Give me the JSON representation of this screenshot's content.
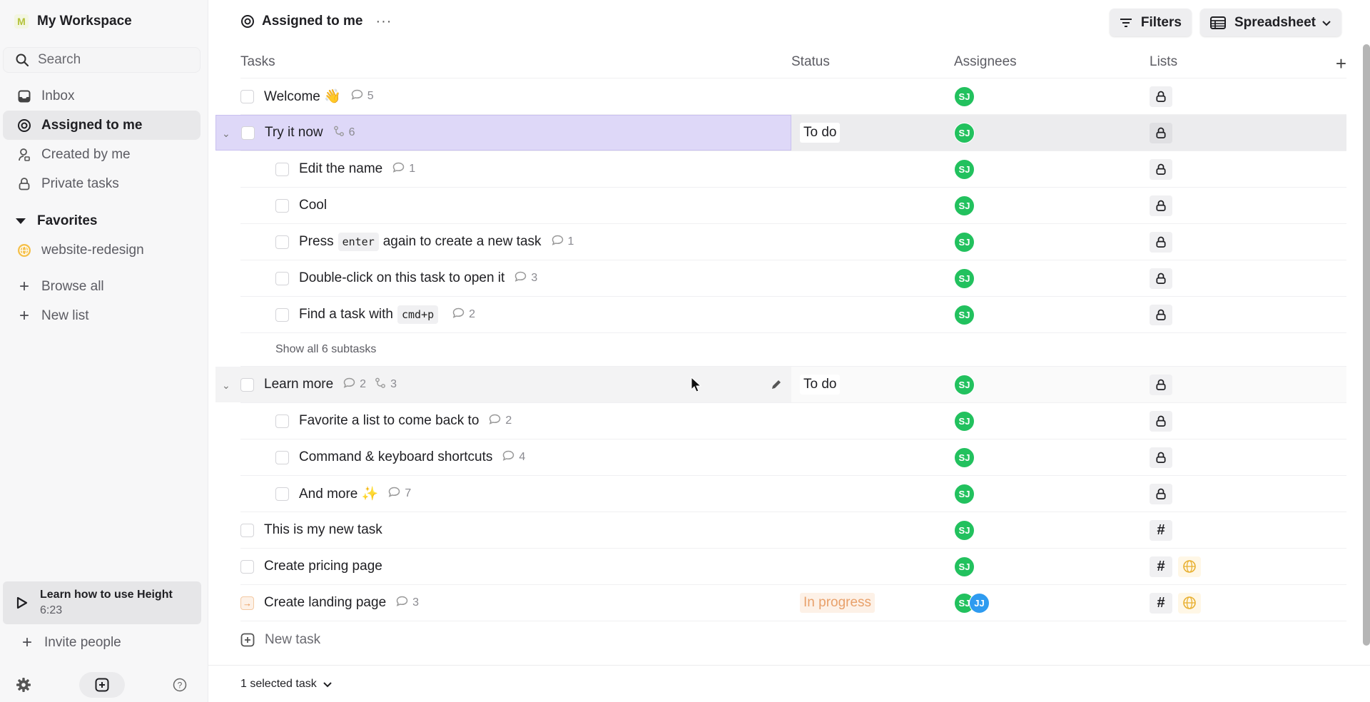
{
  "workspace": {
    "initial": "M",
    "name": "My Workspace"
  },
  "search": {
    "placeholder": "Search"
  },
  "sidebar": {
    "nav": [
      {
        "label": "Inbox",
        "icon": "inbox-icon"
      },
      {
        "label": "Assigned to me",
        "icon": "target-icon",
        "active": true
      },
      {
        "label": "Created by me",
        "icon": "user-icon"
      },
      {
        "label": "Private tasks",
        "icon": "lock-icon"
      }
    ],
    "favorites_label": "Favorites",
    "favorites": [
      {
        "label": "website-redesign",
        "icon": "globe-icon"
      }
    ],
    "browse_all": "Browse all",
    "new_list": "New list",
    "learn": {
      "title": "Learn how to use Height",
      "duration": "6:23"
    },
    "invite": "Invite people"
  },
  "header": {
    "title": "Assigned to me",
    "more": "···",
    "filters": "Filters",
    "view": "Spreadsheet"
  },
  "columns": {
    "tasks": "Tasks",
    "status": "Status",
    "assignees": "Assignees",
    "lists": "Lists",
    "add": "+"
  },
  "rows": [
    {
      "name": "Welcome 👋",
      "comments": "5"
    },
    {
      "name": "Try it now",
      "subtasks": "6",
      "status": "To do"
    },
    {
      "name": "Edit the name",
      "comments": "1"
    },
    {
      "name": "Cool"
    },
    {
      "pre": "Press",
      "kbd": "enter",
      "post": "again to create a new task",
      "comments": "1"
    },
    {
      "name": "Double-click on this task to open it",
      "comments": "3"
    },
    {
      "pre": "Find a task with",
      "kbd": "cmd+p",
      "comments": "2"
    },
    {
      "name": "Learn more",
      "comments": "2",
      "subtasks": "3",
      "status": "To do"
    },
    {
      "name": "Favorite a list to come back to",
      "comments": "2"
    },
    {
      "name": "Command & keyboard shortcuts",
      "comments": "4"
    },
    {
      "name": "And more ✨",
      "comments": "7"
    },
    {
      "name": "This is my new task"
    },
    {
      "name": "Create pricing page"
    },
    {
      "name": "Create landing page",
      "comments": "3",
      "status": "In progress"
    }
  ],
  "show_all": "Show all 6 subtasks",
  "assignee": {
    "primary": "SJ",
    "secondary": "JJ"
  },
  "list_hash": "#",
  "new_task": "New task",
  "footer": {
    "selected": "1 selected task"
  },
  "colors": {
    "accent_selected": "#ded8f8",
    "avatar_green": "#22c15e",
    "avatar_blue": "#2e9bf0",
    "in_progress": "#e8a06a"
  }
}
